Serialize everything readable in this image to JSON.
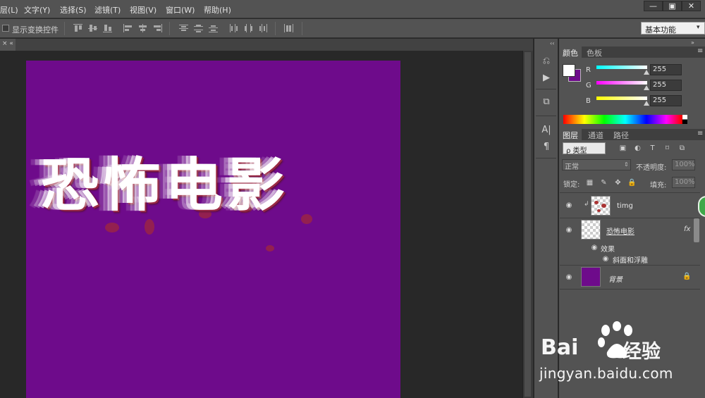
{
  "menu": {
    "items": [
      "层(L)",
      "文字(Y)",
      "选择(S)",
      "滤镜(T)",
      "视图(V)",
      "窗口(W)",
      "帮助(H)"
    ]
  },
  "window_controls": {
    "minimize": "—",
    "restore": "▣",
    "close": "✕"
  },
  "options": {
    "show_transform_label": "显示变换控件",
    "workspace": "基本功能"
  },
  "doc_tab": {
    "label": "× «"
  },
  "canvas": {
    "background_color": "#6e0b8b",
    "title_text": "恐怖电影"
  },
  "color_panel": {
    "tabs": [
      "颜色",
      "色板"
    ],
    "channels": [
      {
        "label": "R",
        "value": "255",
        "gradient": "#00ffff"
      },
      {
        "label": "G",
        "value": "255",
        "gradient": "#ff00ff"
      },
      {
        "label": "B",
        "value": "255",
        "gradient": "#ffff00"
      }
    ],
    "foreground": "#ffffff",
    "background": "#6e0b8b"
  },
  "layers_panel": {
    "tabs": [
      "图层",
      "通道",
      "路径"
    ],
    "filter_kind": "ρ 类型",
    "blend_mode": "正常",
    "opacity_label": "不透明度:",
    "opacity_value": "100%",
    "lock_label": "锁定:",
    "fill_label": "填充:",
    "fill_value": "100%",
    "layers": [
      {
        "name": "timg",
        "type": "image"
      },
      {
        "name": "恐怖电影",
        "type": "text",
        "fx": "fx"
      },
      {
        "name": "背景",
        "type": "background"
      }
    ],
    "effects_label": "效果",
    "effect_item": "斜面和浮雕"
  },
  "watermark": {
    "brand": "Bai",
    "brand_cn": "经验",
    "url": "jingyan.baidu.com"
  }
}
